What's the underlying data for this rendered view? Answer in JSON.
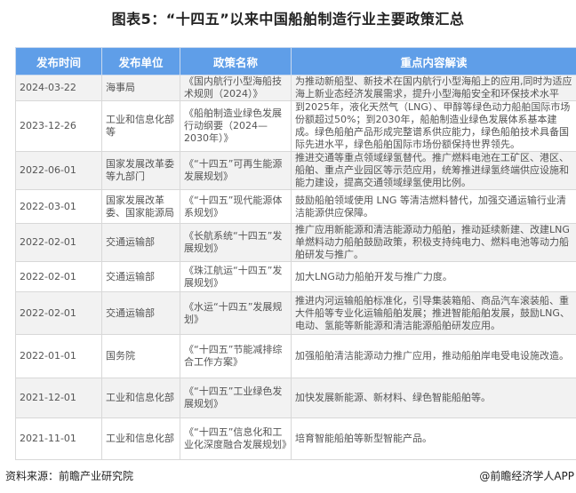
{
  "title": "图表5：“十四五”以来中国船舶制造行业主要政策汇总",
  "table": {
    "headers": [
      "发布时间",
      "发布单位",
      "政策名称",
      "重点内容解读"
    ],
    "rows": [
      [
        "2024-03-22",
        "海事局",
        "《国内航行小型海船技术规则（2024）》",
        "为推动新船型、新技术在国内航行小型海船上的应用,同时为适应海上新业态经济发展需求，提升小型海船安全和环保技术水平"
      ],
      [
        "2023-12-26",
        "工业和信息化部等",
        "《船舶制造业绿色发展行动纲要（2024—2030年）》",
        "到2025年，液化天然气（LNG）、甲醇等绿色动力船舶国际市场份额超过50%；到2030年，船舶制造业绿色发展体系基本建成。绿色船舶产品形成完整谱系供应能力，绿色船舶技术具备国际先进水平，绿色船舶国际市场份额保持世界领先。"
      ],
      [
        "2022-06-01",
        "国家发展改革委等九部门",
        "《“十四五”可再生能源发展规划》",
        "推进交通等重点领域绿氢替代。推广燃料电池在工矿区、港区、船舶、重点产业园区等示范应用，统筹推进绿氢终端供应设施和能力建设，提高交通领域绿氢使用比例。"
      ],
      [
        "2022-03-01",
        "国家发展改革委、国家能源局",
        "《“十四五”现代能源体系规划》",
        "鼓励船舶领域使用 LNG 等清洁燃料替代，加强交通运输行业清洁能源供应保障。"
      ],
      [
        "2022-02-01",
        "交通运输部",
        "《长航系统“十四五”发展规划》",
        "推广应用新能源和清洁能源动力船舶，推动延续新建、改建LNG单燃料动力船舶鼓励政策，积极支持纯电力、燃料电池等动力船舶研发与推广。"
      ],
      [
        "2022-02-01",
        "交通运输部",
        "《珠江航运“十四五”发展规划》",
        "加大LNG动力船舶开发与推广力度。"
      ],
      [
        "2022-02-01",
        "交通运输部",
        "《水运“十四五”发展规划》",
        "推进内河运输船舶标准化，引导集装箱船、商品汽车滚装船、重大件船等专业化运输船舶发展；推进智能船舶发展，鼓励LNG、电动、氢能等新能源和清洁能源船舶研发应用。"
      ],
      [
        "2022-01-01",
        "国务院",
        "《“十四五”节能减排综合工作方案》",
        "加强船舶清洁能源动力推广应用，推动船舶岸电受电设施改造。"
      ],
      [
        "2021-12-01",
        "工业和信息化部",
        "《“十四五”工业绿色发展规划》",
        "加快发展新能源、新材料、绿色智能船舶等。"
      ],
      [
        "2021-11-01",
        "工业和信息化部",
        "《“十四五”信息化和工业化深度融合发展规划》",
        "培育智能船舶等新型智能产品。"
      ]
    ]
  },
  "footer": {
    "source": "资料来源：前瞻产业研究院",
    "credit": "@前瞻经济学人APP"
  },
  "watermark": "前瞻产业研究院",
  "colors": {
    "header_bg": "#5f9ee8",
    "alt_row": "#f2f2f2"
  }
}
